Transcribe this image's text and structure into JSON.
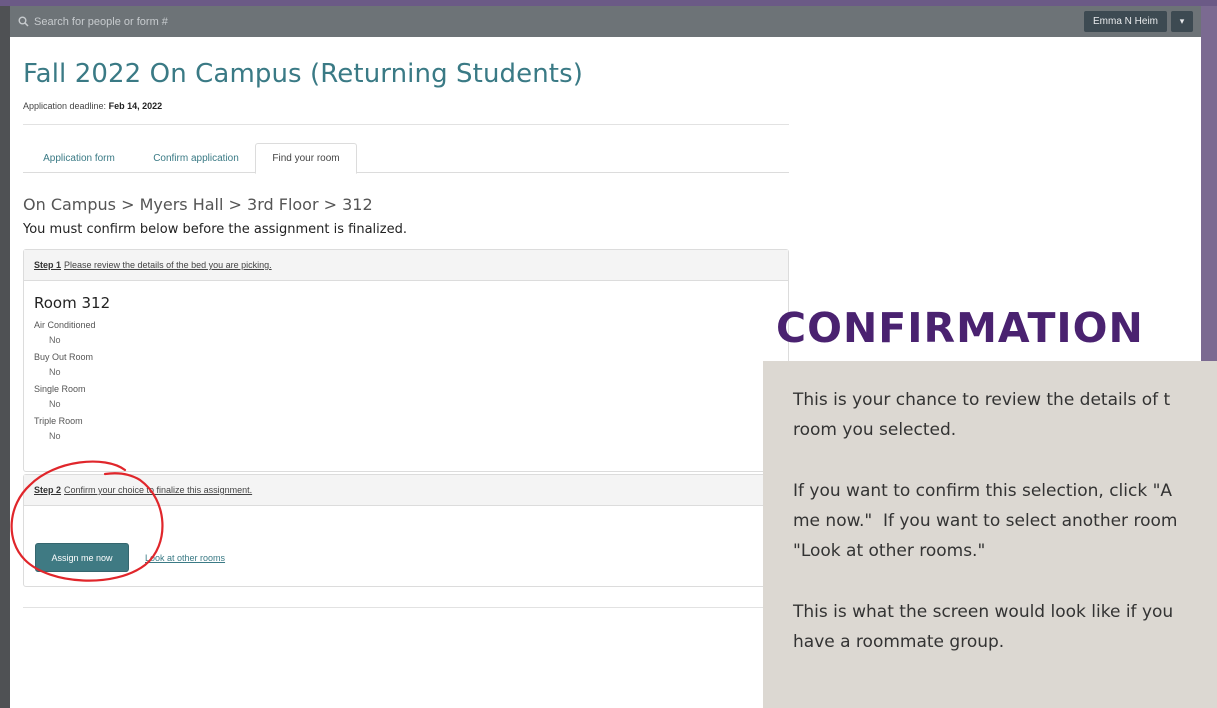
{
  "topbar": {
    "search_placeholder": "Search for people or form #",
    "user_name": "Emma N Heim",
    "user_caret": "▾"
  },
  "header": {
    "title": "Fall 2022 On Campus (Returning Students)",
    "deadline_label": "Application deadline:",
    "deadline_value": "Feb 14, 2022"
  },
  "tabs": [
    {
      "label": "Application form"
    },
    {
      "label": "Confirm application"
    },
    {
      "label": "Find your room"
    }
  ],
  "breadcrumb": "On Campus > Myers Hall > 3rd Floor > 312",
  "notice": "You must confirm below before the assignment is finalized.",
  "step1": {
    "step_label": "Step 1",
    "text": "Please review the details of the bed you are picking.",
    "room_title": "Room 312",
    "attributes": [
      {
        "label": "Air Conditioned",
        "value": "No"
      },
      {
        "label": "Buy Out Room",
        "value": "No"
      },
      {
        "label": "Single Room",
        "value": "No"
      },
      {
        "label": "Triple Room",
        "value": "No"
      }
    ]
  },
  "step2": {
    "step_label": "Step 2",
    "text": "Confirm your choice to finalize this assignment.",
    "assign_button": "Assign me now",
    "other_link": "Look at other rooms"
  },
  "overlay": {
    "heading": "CONFIRMATION",
    "paragraphs": [
      "This is your chance to review the details of t\nroom you selected.",
      "If you want to confirm this selection, click \"A\nme now.\"  If you want to select another room\n\"Look at other rooms.\"",
      "This is what the screen would look like if you\nhave a roommate group."
    ]
  },
  "colors": {
    "accent_teal": "#3a7a85",
    "button_teal": "#3f7a83",
    "heading_purple": "#4a2270",
    "annotation_red": "#e0262b",
    "overlay_bg": "#dcd8d2"
  }
}
